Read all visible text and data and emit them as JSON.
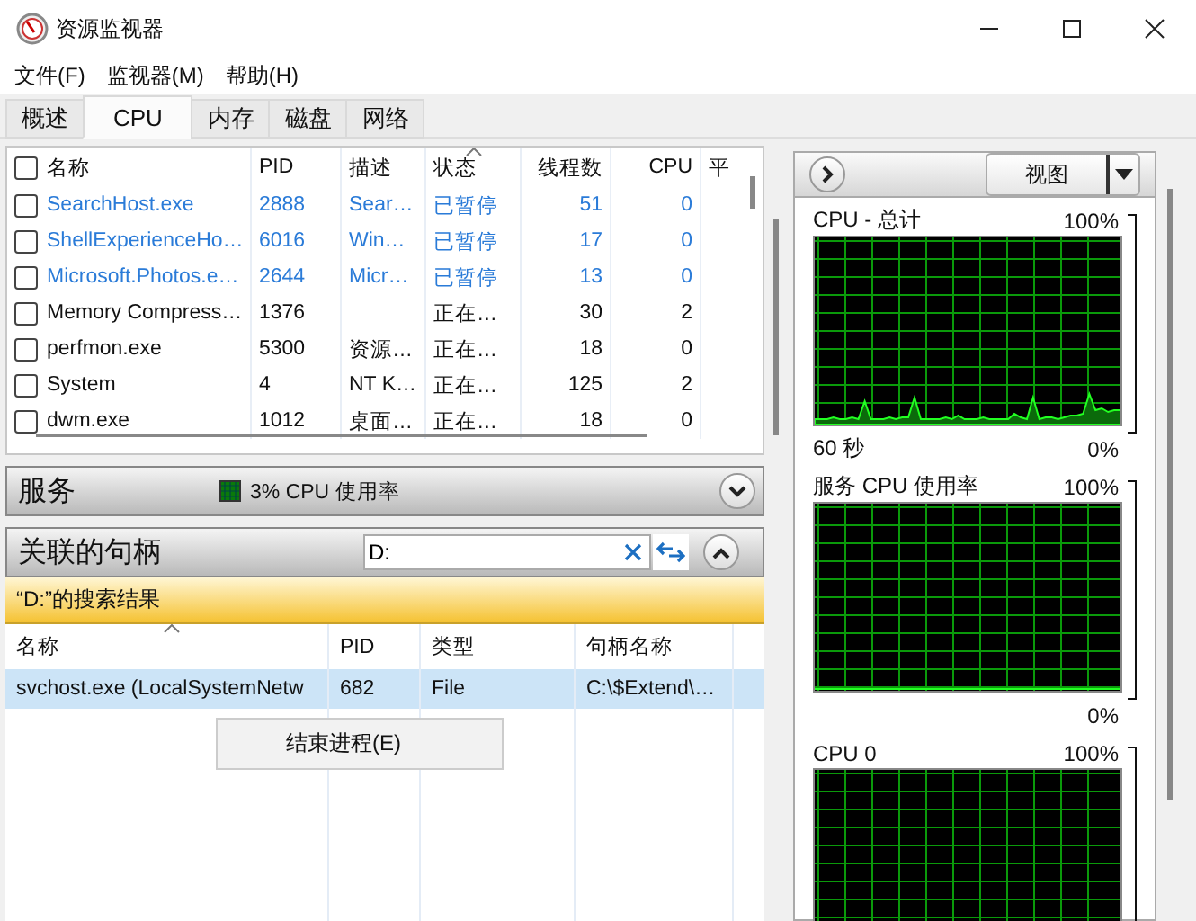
{
  "window": {
    "title": "资源监视器"
  },
  "menu": [
    "文件(F)",
    "监视器(M)",
    "帮助(H)"
  ],
  "tabs": [
    {
      "label": "概述",
      "selected": false
    },
    {
      "label": "CPU",
      "selected": true
    },
    {
      "label": "内存",
      "selected": false
    },
    {
      "label": "磁盘",
      "selected": false
    },
    {
      "label": "网络",
      "selected": false
    }
  ],
  "processes": {
    "all_checked": false,
    "columns": [
      "名称",
      "PID",
      "描述",
      "状态",
      "线程数",
      "CPU",
      "平"
    ],
    "rows": [
      {
        "checked": false,
        "suspended": true,
        "cells": [
          "SearchHost.exe",
          "2888",
          "Sear…",
          "已暂停",
          "51",
          "0"
        ]
      },
      {
        "checked": false,
        "suspended": true,
        "cells": [
          "ShellExperienceHo…",
          "6016",
          "Win…",
          "已暂停",
          "17",
          "0"
        ]
      },
      {
        "checked": false,
        "suspended": true,
        "cells": [
          "Microsoft.Photos.e…",
          "2644",
          "Micr…",
          "已暂停",
          "13",
          "0"
        ]
      },
      {
        "checked": false,
        "suspended": false,
        "cells": [
          "Memory Compress…",
          "1376",
          "",
          "正在…",
          "30",
          "2"
        ]
      },
      {
        "checked": false,
        "suspended": false,
        "cells": [
          "perfmon.exe",
          "5300",
          "资源…",
          "正在…",
          "18",
          "0"
        ]
      },
      {
        "checked": false,
        "suspended": false,
        "cells": [
          "System",
          "4",
          "NT K…",
          "正在…",
          "125",
          "2"
        ]
      },
      {
        "checked": false,
        "suspended": false,
        "cells": [
          "dwm.exe",
          "1012",
          "桌面…",
          "正在…",
          "18",
          "0"
        ]
      }
    ]
  },
  "services": {
    "title": "服务",
    "summary": "3% CPU 使用率",
    "expanded": false
  },
  "handles": {
    "title": "关联的句柄",
    "search_value": "D:",
    "expanded": true,
    "banner": "“D:”的搜索结果",
    "columns": [
      "名称",
      "PID",
      "类型",
      "句柄名称"
    ],
    "rows": [
      {
        "selected": true,
        "cells": [
          "svchost.exe (LocalSystemNetw",
          "682",
          "File",
          "C:\\$Extend\\…"
        ]
      }
    ]
  },
  "context_menu": [
    "结束进程(E)"
  ],
  "view_button": "视图",
  "graphs": [
    {
      "title": "CPU - 总计",
      "max_label": "100%",
      "time_label": "60 秒",
      "min_label": "0%"
    },
    {
      "title": "服务 CPU 使用率",
      "max_label": "100%",
      "min_label": "0%"
    },
    {
      "title": "CPU 0",
      "max_label": "100%"
    }
  ]
}
